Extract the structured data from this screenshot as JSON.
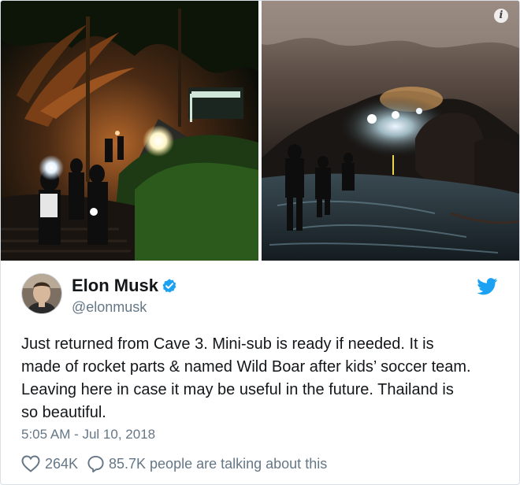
{
  "media": {
    "left_photo_icon": "night-camp-photo",
    "right_photo_icon": "cave-rescue-photo",
    "info_badge": "i"
  },
  "author": {
    "avatar_icon": "profile-avatar",
    "name": "Elon Musk",
    "handle": "@elonmusk",
    "verified_icon": "verified-badge-icon"
  },
  "brand": {
    "icon": "twitter-bird-icon",
    "color": "#1da1f2"
  },
  "tweet": {
    "text_lines": [
      "Just returned from Cave 3. Mini-sub is ready if needed. It is",
      "made of rocket parts & named Wild Boar after kids’ soccer team.",
      "Leaving here in case it may be useful in the future. Thailand is",
      "so beautiful."
    ],
    "timestamp": "5:05 AM - Jul 10, 2018"
  },
  "actions": {
    "like_icon": "heart-icon",
    "like_count": "264K",
    "comment_icon": "comment-icon",
    "talking": "85.7K people are talking about this"
  },
  "colors": {
    "text_primary": "#14171a",
    "text_secondary": "#657786",
    "card_border": "#d9dfe4",
    "verified_blue": "#1da1f2"
  }
}
